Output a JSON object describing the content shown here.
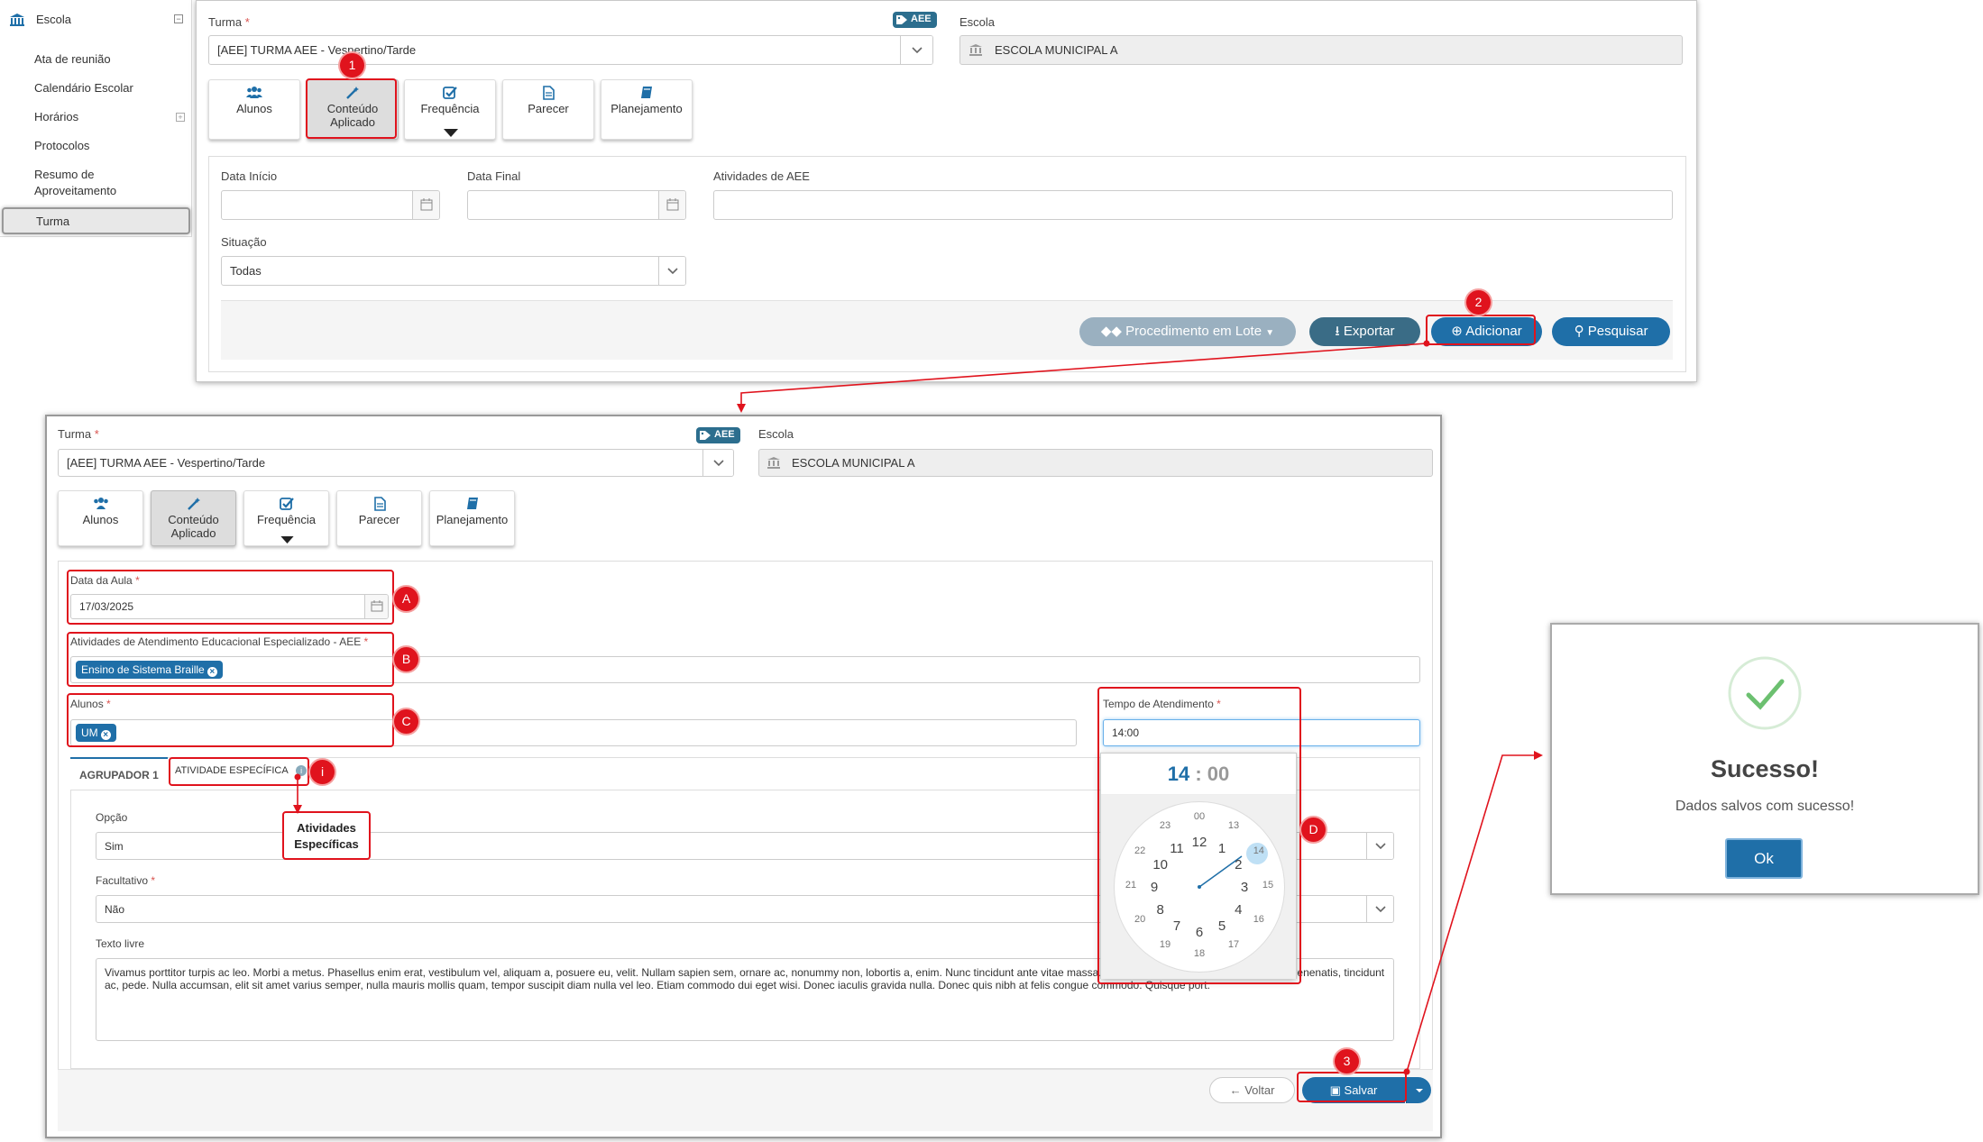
{
  "sidebar": {
    "section": "Escola",
    "items": [
      "Ata de reunião",
      "Calendário Escolar",
      "Horários",
      "Protocolos",
      "Resumo de",
      "Aproveitamento"
    ],
    "active": "Turma"
  },
  "top": {
    "turma_label": "Turma",
    "turma_value": "[AEE]  TURMA AEE - Vespertino/Tarde",
    "aee_badge": "AEE",
    "escola_label": "Escola",
    "escola_value": "ESCOLA MUNICIPAL A",
    "tiles": {
      "alunos": "Alunos",
      "conteudo": "Conteúdo Aplicado",
      "frequencia": "Frequência",
      "parecer": "Parecer",
      "planejamento": "Planejamento"
    },
    "data_inicio_label": "Data Início",
    "data_final_label": "Data Final",
    "atividades_label": "Atividades de AEE",
    "situacao_label": "Situação",
    "situacao_value": "Todas",
    "btn_lote": "Procedimento em Lote",
    "btn_exportar": "Exportar",
    "btn_adicionar": "Adicionar",
    "btn_pesquisar": "Pesquisar"
  },
  "form": {
    "turma_label": "Turma",
    "turma_value": "[AEE]  TURMA AEE - Vespertino/Tarde",
    "aee_badge": "AEE",
    "escola_label": "Escola",
    "escola_value": "ESCOLA MUNICIPAL A",
    "tiles": {
      "alunos": "Alunos",
      "conteudo": "Conteúdo Aplicado",
      "frequencia": "Frequência",
      "parecer": "Parecer",
      "planejamento": "Planejamento"
    },
    "data_aula_label": "Data da Aula",
    "data_aula_value": "17/03/2025",
    "atividades_label": "Atividades de Atendimento Educacional Especializado - AEE",
    "atividade_chip": "Ensino de Sistema Braille",
    "alunos_label": "Alunos",
    "aluno_chip": "UM",
    "tempo_label": "Tempo de Atendimento",
    "tempo_value": "14:00",
    "tab_agrupador": "AGRUPADOR 1",
    "tab_atividade": "ATIVIDADE ESPECÍFICA",
    "opcao_label": "Opção",
    "opcao_value": "Sim",
    "facultativo_label": "Facultativo",
    "facultativo_value": "Não",
    "texto_label": "Texto livre",
    "texto_value": "Vivamus porttitor turpis ac leo. Morbi a metus. Phasellus enim erat, vestibulum vel, aliquam a, posuere eu, velit. Nullam sapien sem, ornare ac, nonummy non, lobortis a, enim. Nunc tincidunt ante vitae massa. Duis ante orci, molestie vitae, vehicula venenatis, tincidunt ac, pede. Nulla accumsan, elit sit amet varius semper, nulla mauris mollis quam, tempor suscipit diam nulla vel leo. Etiam commodo dui eget wisi. Donec iaculis gravida nulla. Donec quis nibh at felis congue commodo. Quisque port.",
    "btn_voltar": "Voltar",
    "btn_salvar": "Salvar"
  },
  "clock": {
    "hour": "14",
    "sep": ":",
    "minute": "00",
    "outer": [
      "12",
      "1",
      "2",
      "3",
      "4",
      "5",
      "6",
      "7",
      "8",
      "9",
      "10",
      "11"
    ],
    "inner": [
      "00",
      "13",
      "14",
      "15",
      "16",
      "17",
      "18",
      "19",
      "20",
      "21",
      "22",
      "23"
    ],
    "selected": "14"
  },
  "annotations": {
    "m1": "1",
    "m2": "2",
    "m3": "3",
    "mA": "A",
    "mB": "B",
    "mC": "C",
    "mD": "D",
    "mi": "i",
    "callout": "Atividades Específicas"
  },
  "success": {
    "title": "Sucesso!",
    "message": "Dados salvos com sucesso!",
    "ok": "Ok"
  },
  "colors": {
    "primary": "#1f6fa8",
    "annotation": "#e0131d",
    "success": "#6cc070"
  }
}
